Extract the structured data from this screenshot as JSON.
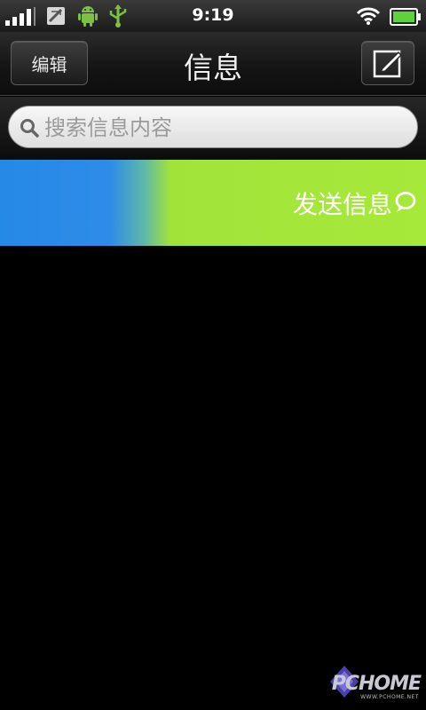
{
  "status_bar": {
    "time": "9:19",
    "icons": [
      "signal-icon",
      "sms-notification-icon",
      "android-debug-icon",
      "usb-icon",
      "wifi-icon",
      "battery-icon"
    ]
  },
  "header": {
    "title": "信息",
    "edit_label": "编辑",
    "compose_icon": "compose-icon"
  },
  "search": {
    "placeholder": "搜索信息内容",
    "value": ""
  },
  "swipe_action": {
    "label": "发送信息",
    "icon": "speech-bubble-icon"
  },
  "watermark": {
    "text": "PCHOME",
    "sub": "WWW.PCHOME.NET"
  },
  "colors": {
    "accent_blue": "#2589e6",
    "accent_green": "#a6e93a",
    "android_green": "#7cc142"
  }
}
